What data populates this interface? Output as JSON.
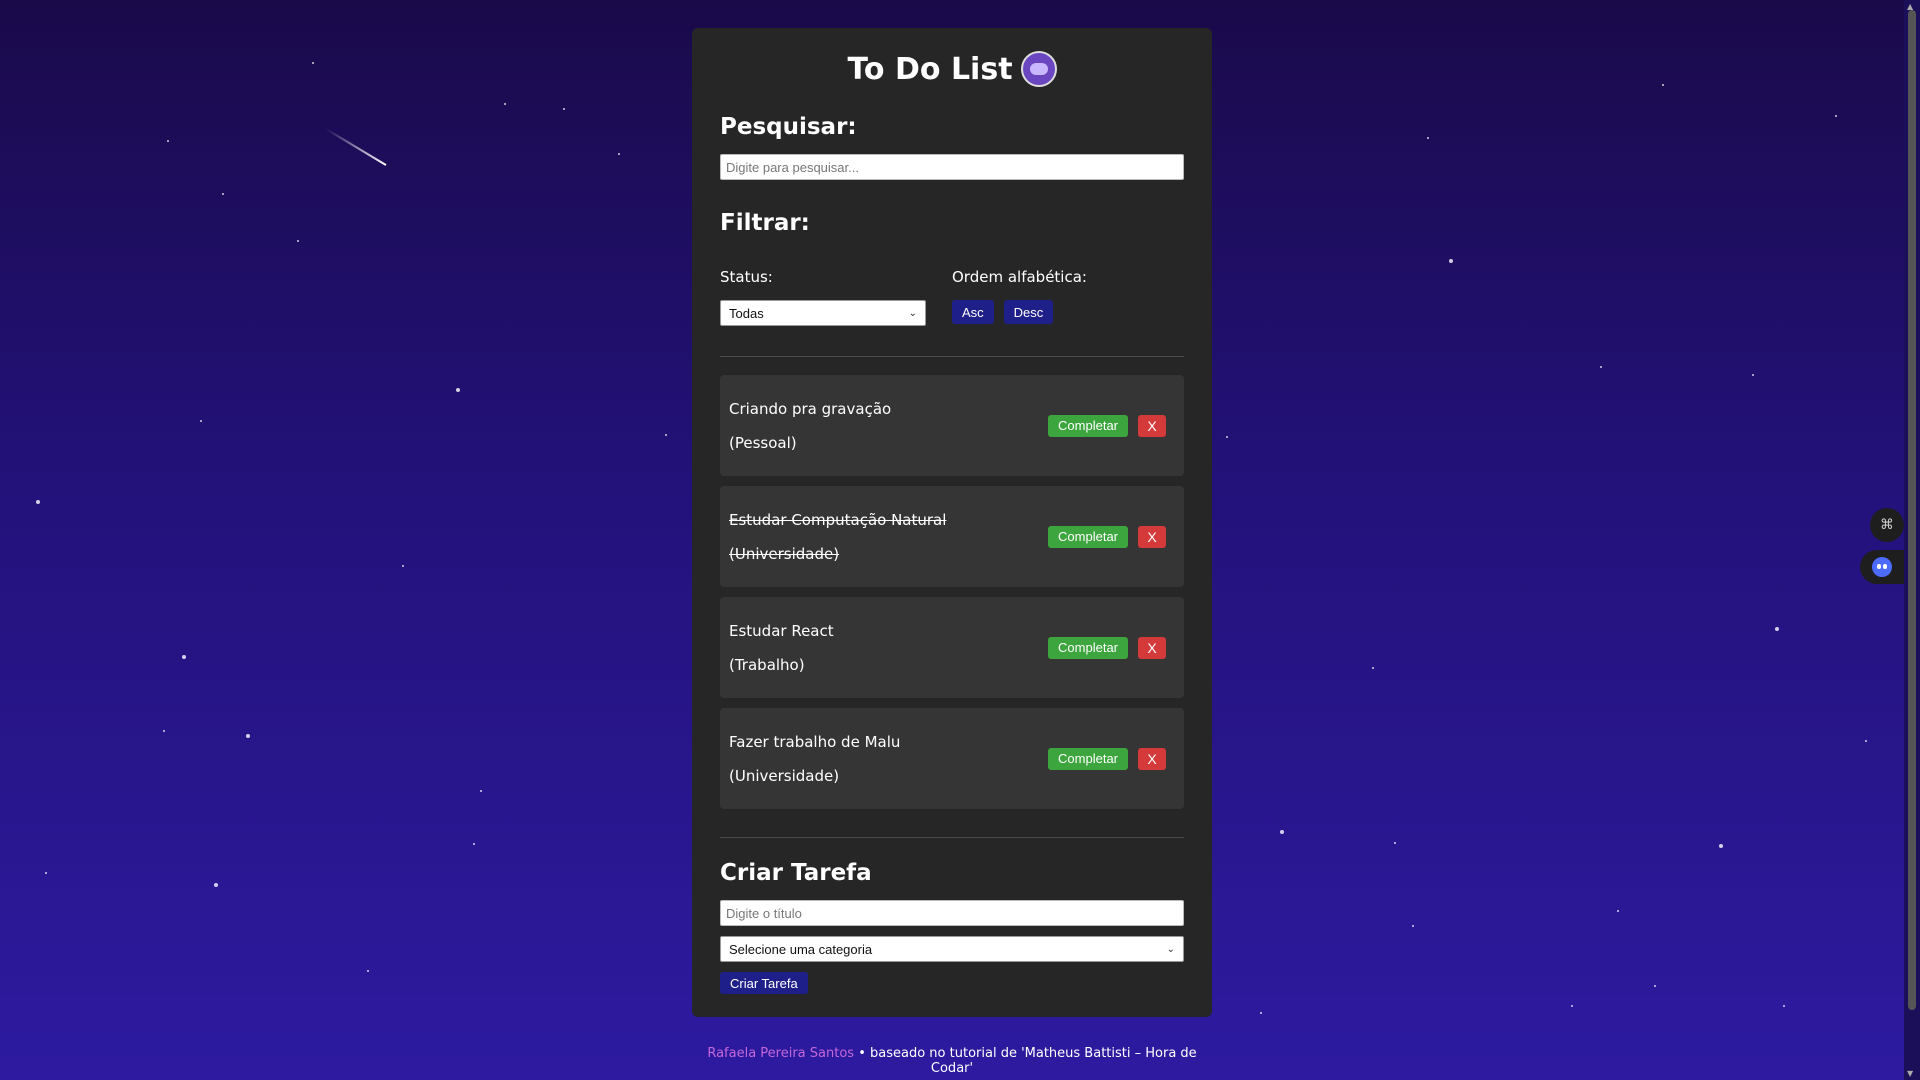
{
  "app": {
    "title": "To Do List"
  },
  "search": {
    "heading": "Pesquisar:",
    "placeholder": "Digite para pesquisar..."
  },
  "filter": {
    "heading": "Filtrar:",
    "status_label": "Status:",
    "status_value": "Todas",
    "order_label": "Ordem alfabética:",
    "asc_label": "Asc",
    "desc_label": "Desc"
  },
  "todos": [
    {
      "text": "Criando pra gravação",
      "category": "(Pessoal)",
      "completed": false,
      "complete_label": "Completar",
      "remove_label": "X"
    },
    {
      "text": "Estudar Computação Natural",
      "category": "(Universidade)",
      "completed": true,
      "complete_label": "Completar",
      "remove_label": "X"
    },
    {
      "text": "Estudar React",
      "category": "(Trabalho)",
      "completed": false,
      "complete_label": "Completar",
      "remove_label": "X"
    },
    {
      "text": "Fazer trabalho de Malu",
      "category": "(Universidade)",
      "completed": false,
      "complete_label": "Completar",
      "remove_label": "X"
    }
  ],
  "create": {
    "heading": "Criar Tarefa",
    "title_placeholder": "Digite o título",
    "category_value": "Selecione uma categoria",
    "button_label": "Criar Tarefa"
  },
  "footer": {
    "author": "Rafaela Pereira Santos",
    "separator": "•",
    "text": "baseado no tutorial de 'Matheus Battisti – Hora de Codar'"
  },
  "colors": {
    "background": "#23127a",
    "card": "#262626",
    "todo": "#353535",
    "complete_button": "#3da53d",
    "remove_button": "#d43a3a",
    "navy_button": "#1f1f8a",
    "author_link": "#c467d9"
  },
  "icons": {
    "logo": "ghost-logo-icon",
    "dock_top": "grid-icon",
    "dock_bottom": "ghost-icon",
    "select_chevron": "chevron-down-icon"
  }
}
